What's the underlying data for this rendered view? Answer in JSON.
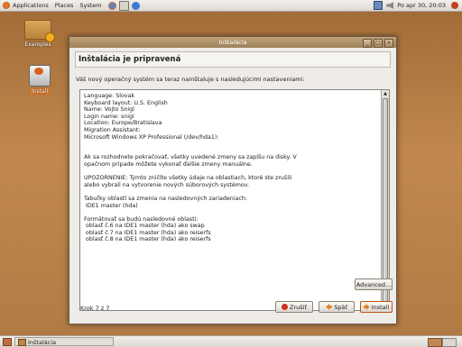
{
  "top_panel": {
    "menus": [
      "Applications",
      "Places",
      "System"
    ],
    "clock": "Po apr 30, 20:03"
  },
  "desktop": {
    "icons": [
      {
        "label": "Examples",
        "icon": "folder-icon"
      },
      {
        "label": "Install",
        "icon": "installer-icon"
      }
    ]
  },
  "window": {
    "title": "Inštalácia",
    "controls": [
      "_",
      "□",
      "×"
    ],
    "header": "Inštalácia je pripravená",
    "intro": "Váš nový operačný systém sa teraz nainštaluje s nasledujúcimi nastaveniami:",
    "summary": "Language: Slovak\nKeyboard layout: U.S. English\nName: Vojto Snigl\nLogin name: snigi\nLocation: Europe/Bratislava\nMigration Assistant:\nMicrosoft Windows XP Professional (/dev/hda1):\n\n\nAk sa rozhodnete pokračovať, všetky uvedené zmeny sa zapíšu na disky. V\nopačnom prípade môžete vykonať ďalšie zmeny manuálne.\n\nUPOZORNENIE: Týmto zničíte všetky údaje na oblastiach, ktoré ste zrušili\nalebo vybrali na vytvorenie nových súborových systémov.\n\nTabuľky oblastí sa zmenia na nasledovných zariadeniach:\n IDE1 master (hda)\n\nFormátovať sa budú nasledovné oblasti:\n oblasť č.6 na IDE1 master (hda) ako swap\n oblasť č.7 na IDE1 master (hda) ako reiserfs\n oblasť č.8 na IDE1 master (hda) ako reiserfs",
    "advanced_label": "Advanced...",
    "step_text": "Krok 7 z 7",
    "cancel_label": "Zrušiť",
    "back_label": "Späť",
    "install_label": "Install"
  },
  "bottom_panel": {
    "task_label": "Inštalácia"
  },
  "colors": {
    "accent": "#e07828",
    "titlebar": "#b09068",
    "desktop": "#b07a44"
  }
}
